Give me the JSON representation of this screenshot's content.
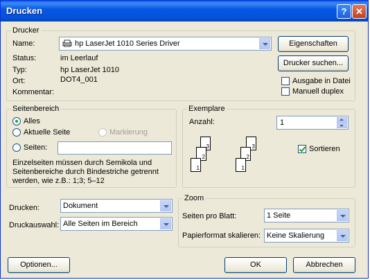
{
  "window": {
    "title": "Drucken"
  },
  "printer": {
    "legend": "Drucker",
    "name_label": "Name:",
    "name_value": "hp LaserJet 1010 Series Driver",
    "properties_button": "Eigenschaften",
    "find_printer_button": "Drucker suchen...",
    "status_label": "Status:",
    "status_value": "im Leerlauf",
    "type_label": "Typ:",
    "type_value": "hp LaserJet 1010",
    "location_label": "Ort:",
    "location_value": "DOT4_001",
    "comment_label": "Kommentar:",
    "print_to_file_label": "Ausgabe in Datei",
    "print_to_file_checked": false,
    "manual_duplex_label": "Manuell duplex",
    "manual_duplex_checked": false
  },
  "page_range": {
    "legend": "Seitenbereich",
    "all_label": "Alles",
    "current_page_label": "Aktuelle Seite",
    "selection_label": "Markierung",
    "pages_label": "Seiten:",
    "pages_value": "",
    "help_text": "Einzelseiten müssen durch Semikola und Seitenbereiche durch Bindestriche getrennt werden, wie z.B.: 1;3; 5–12",
    "selected": "all"
  },
  "copies": {
    "legend": "Exemplare",
    "count_label": "Anzahl:",
    "count_value": "1",
    "collate_label": "Sortieren",
    "collate_checked": true,
    "page_numbers": [
      "1",
      "2",
      "3"
    ]
  },
  "print_what": {
    "label": "Drucken:",
    "value": "Dokument"
  },
  "print_selection": {
    "label": "Druckauswahl:",
    "value": "Alle Seiten im Bereich"
  },
  "zoom": {
    "legend": "Zoom",
    "pages_per_sheet_label": "Seiten pro Blatt:",
    "pages_per_sheet_value": "1 Seite",
    "scale_label": "Papierformat skalieren:",
    "scale_value": "Keine Skalierung"
  },
  "footer": {
    "options_button": "Optionen...",
    "ok_button": "OK",
    "cancel_button": "Abbrechen"
  },
  "colors": {
    "titlebar": "#0858e5",
    "face": "#ece9d8",
    "check": "#21a121"
  }
}
